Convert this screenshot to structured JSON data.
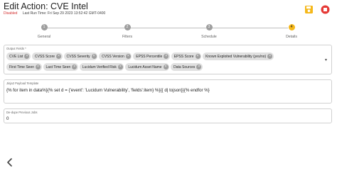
{
  "header": {
    "title": "Edit Action: CVE Intel",
    "status": "Disabled",
    "last_run": "Last Run Time: Fri Sep 29 2023 13:52:42 GMT-0400"
  },
  "steps": [
    {
      "number": "1",
      "label": "General"
    },
    {
      "number": "2",
      "label": "Filters"
    },
    {
      "number": "3",
      "label": "Schedule"
    },
    {
      "number": "4",
      "label": "Details"
    }
  ],
  "output_fields": {
    "label": "Output Fields *",
    "chips_row1": [
      "CVE List",
      "CVSS Score",
      "CVSS Severity",
      "CVSS Version",
      "EPSS Percentile",
      "EPSS Score",
      "Known Exploited Vulnerability (yes/no)"
    ],
    "chips_row2": [
      "First Time Seen",
      "Last Time Seen",
      "Lucidum Verified Risk",
      "Lucidum Asset Name",
      "Data Sources"
    ]
  },
  "jinja": {
    "label": "Jinja2 Payload Template",
    "value": "{% for item in data%}{% set d = {'event': 'Lucidum Vulnerability', 'fields':item} %}{{ d| tojson}}{% endfor %}"
  },
  "dedupe": {
    "label": "De-dupe Previous Jobs",
    "value": "0"
  },
  "colors": {
    "accent": "#f5b81a",
    "stop": "#e53935",
    "disabled_text": "#d32f2f"
  }
}
